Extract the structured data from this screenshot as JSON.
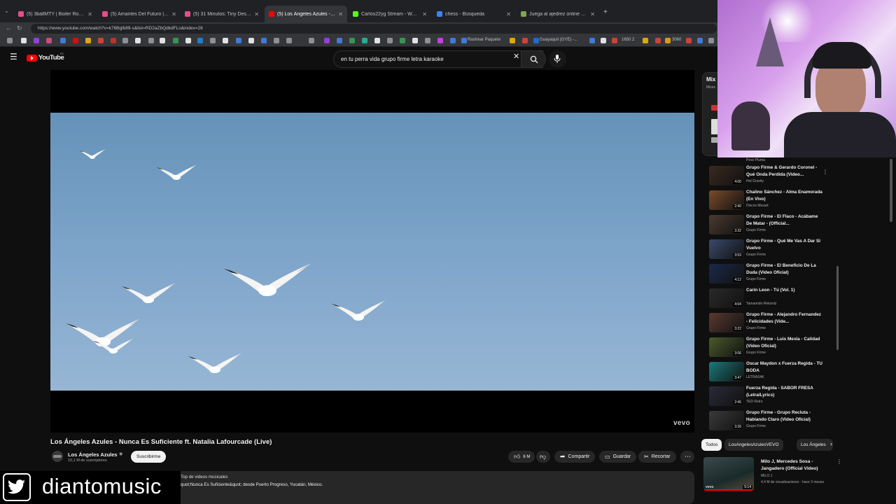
{
  "browser": {
    "tabs": [
      {
        "title": "(5) 3ballMTY | Boiler Room SYSTE",
        "color": "#e84d89",
        "active": false
      },
      {
        "title": "(5) Amantes Del Futuro | Boiler Ro",
        "color": "#e84d89",
        "active": false
      },
      {
        "title": "(5) 31 Minutos: Tiny Desk Concert",
        "color": "#e84d89",
        "active": false
      },
      {
        "title": "(5) Los Ángeles Azules - Nunc",
        "color": "#ff0000",
        "active": true
      },
      {
        "title": "Carlos22yg Stream - Watch Live o",
        "color": "#53fc18",
        "active": false
      },
      {
        "title": "chess - Búsqueda",
        "color": "#3b82f6",
        "active": false
      },
      {
        "title": "Juega al ajedrez online GRATIS - A",
        "color": "#7fa650",
        "active": false
      }
    ],
    "new_tab_label": "+",
    "url": "https://www.youtube.com/watch?v=k76Bglb89-s&list=RD2aZbQdkdFLo&index=28",
    "bookmarks": [
      "Rastrear Paquete",
      "Guayaquil (GYE) -...",
      "1650 2",
      "3060"
    ]
  },
  "youtube": {
    "logo_text": "YouTube",
    "logo_sup": "EC",
    "search_value": "en tu perra vida grupo firme letra karaoke",
    "video": {
      "watermark": "vevo",
      "title": "Los Ángeles Azules - Nunca Es Suficiente ft. Natalia Lafourcade (Live)",
      "channel": "Los Ángeles Azules",
      "subscribers": "10,1 M de suscriptores",
      "subscribe_label": "Suscribirme",
      "likes": "6 M",
      "share_label": "Compartir",
      "save_label": "Guardar",
      "clip_label": "Recortar",
      "desc_line1": "Top de videos musicales",
      "desc_line2": "quot;Nunca Es Suficiente&quot; desde Puerto Progreso, Yucatán, México."
    },
    "playlist": {
      "title": "Mix",
      "subtitle": "Mixes",
      "partial_channel": "Peso Pluma",
      "items": [
        {
          "title": "Grupo Firme & Gerardo Coronel - Qué Onda Perdida (Video...",
          "channel": "Hot Gravity",
          "duration": "4:00",
          "thumb_color": "#3a2a20"
        },
        {
          "title": "Chalino Sánchez - Alma Enamorada (En Vivo)",
          "channel": "Discos Musart",
          "duration": "2:40",
          "thumb_color": "#7a4a2a"
        },
        {
          "title": "Grupo Firme - El Flaco - Acábame De Matar - (Official...",
          "channel": "Grupo Firme",
          "duration": "3:32",
          "thumb_color": "#4a3a30"
        },
        {
          "title": "Grupo Firme - Qué Me Vas A Dar Si Vuelvo",
          "channel": "Grupo Firme",
          "duration": "3:53",
          "thumb_color": "#3a4a6a"
        },
        {
          "title": "Grupo Firme - El Beneficio De La Duda (Video Oficial)",
          "channel": "Grupo Firme",
          "duration": "4:12",
          "thumb_color": "#1a2a4a"
        },
        {
          "title": "Carin Leon - Tú (Vol. 1)",
          "channel": "Tamarindo Rekordz",
          "duration": "4:04",
          "thumb_color": "#2a2a2a"
        },
        {
          "title": "Grupo Firme - Alejandro Fernandez - Felicidades (Vide...",
          "channel": "Grupo Firme",
          "duration": "3:22",
          "thumb_color": "#5a3a30"
        },
        {
          "title": "Grupo Firme - Luis Mexia - Calidad (Video Oficial)",
          "channel": "Grupo Firme",
          "duration": "3:06",
          "thumb_color": "#4a5a2a"
        },
        {
          "title": "Oscar Maydon x Fuerza Regida - TU BODA",
          "channel": "LETRAS4K",
          "duration": "3:47",
          "thumb_color": "#1a7a7a"
        },
        {
          "title": "Fuerza Regida - SABOR FRESA (Letra/Lyrics)",
          "channel": "TED Retro",
          "duration": "2:45",
          "thumb_color": "#2a2a3a"
        },
        {
          "title": "Grupo Firme - Grupo Recluta - Hablando Claro (Video Oficial)",
          "channel": "Grupo Firme",
          "duration": "3:26",
          "thumb_color": "#3a3a3a"
        }
      ]
    },
    "chips": [
      "Todos",
      "LosAngelesAzulesVEVO",
      "Los Ángeles"
    ],
    "next_video": {
      "title": "Milo J, Mercedes Sosa - Jangadero (Official Video)",
      "channel": "MILO J",
      "stats": "4,4 M de visualizaciones · hace 3 meses",
      "duration": "5:14",
      "badge": "vevo"
    }
  },
  "overlay": {
    "twitter_handle": "diantomusic"
  },
  "colors": {
    "bg": "#0f0f0f",
    "chrome": "#35363a",
    "brand_red": "#ff0000",
    "twitter": "#ffffff"
  }
}
